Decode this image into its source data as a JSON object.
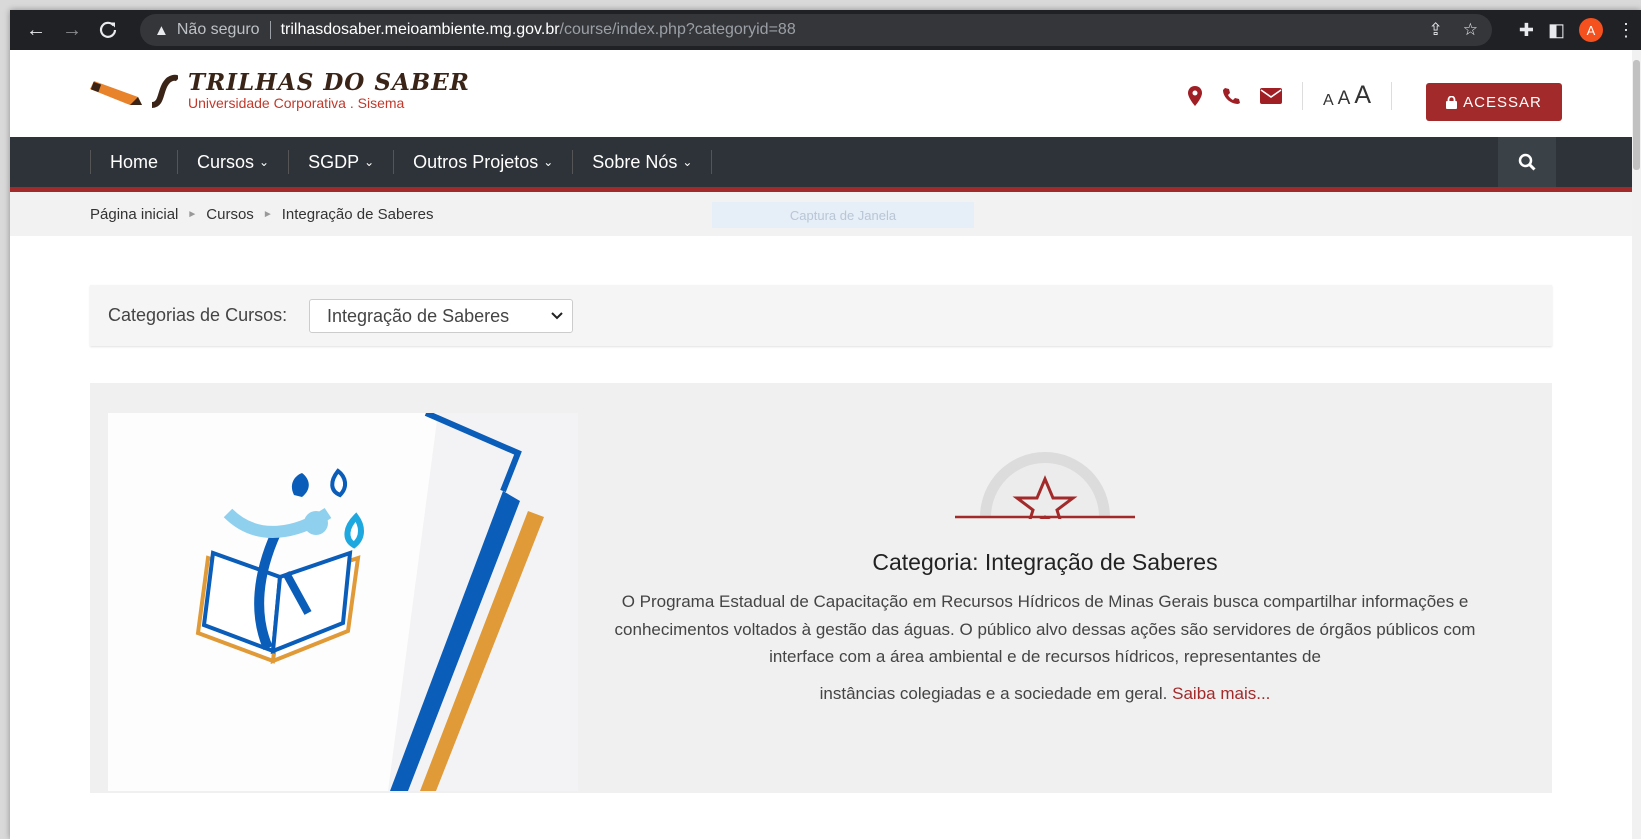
{
  "browser": {
    "security_label": "Não seguro",
    "url_host": "trilhasdosaber.meioambiente.mg.gov.br",
    "url_path": "/course/index.php?categoryid=88",
    "profile_initial": "A"
  },
  "header": {
    "logo_title": "TRILHAS DO SABER",
    "logo_subtitle": "Universidade Corporativa . Sisema",
    "font_small": "A",
    "font_medium": "A",
    "font_large": "A",
    "login_label": "ACESSAR"
  },
  "nav": {
    "items": [
      {
        "label": "Home"
      },
      {
        "label": "Cursos"
      },
      {
        "label": "SGDP"
      },
      {
        "label": "Outros Projetos"
      },
      {
        "label": "Sobre Nós"
      }
    ]
  },
  "breadcrumb": {
    "items": [
      "Página inicial",
      "Cursos",
      "Integração de Saberes"
    ]
  },
  "overlay_text": "Captura de Janela",
  "category_selector": {
    "label": "Categorias de Cursos:",
    "selected": "Integração de Saberes"
  },
  "category": {
    "title": "Categoria: Integração de Saberes",
    "description": "O Programa Estadual de Capacitação em Recursos Hídricos de Minas Gerais busca compartilhar informações e conhecimentos voltados à gestão das águas. O público alvo dessas ações são servidores de órgãos públicos com interface com a área ambiental e de recursos hídricos, representantes de",
    "description_cont": "instâncias colegiadas e a sociedade em geral.",
    "more_label": "Saiba mais..."
  },
  "colors": {
    "brand_red": "#a32a2a",
    "nav_bg": "#2d3338",
    "logo_blue": "#0a5db8",
    "logo_orange": "#e09a38"
  }
}
